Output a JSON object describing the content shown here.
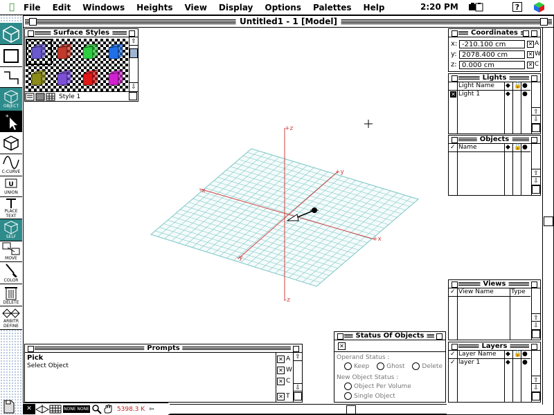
{
  "menubar": {
    "items": [
      "File",
      "Edit",
      "Windows",
      "Heights",
      "View",
      "Display",
      "Options",
      "Palettes",
      "Help"
    ],
    "clock": "2:20 PM"
  },
  "window": {
    "title": "Untitled1 - 1 [Model]"
  },
  "tools": [
    {
      "name": "cube-tool",
      "label": ""
    },
    {
      "name": "rectangle-tool",
      "label": ""
    },
    {
      "name": "step-line-tool",
      "label": ""
    },
    {
      "name": "object-tool",
      "label": "OBJECT"
    },
    {
      "name": "pointer-tool",
      "label": ""
    },
    {
      "name": "cube-wire-tool",
      "label": ""
    },
    {
      "name": "c-curve-tool",
      "label": "C-CURVE"
    },
    {
      "name": "union-tool",
      "label": "UNION"
    },
    {
      "name": "place-text-tool",
      "label": "PLACE TEXT"
    },
    {
      "name": "self-tool",
      "label": "SELF"
    },
    {
      "name": "move-tool",
      "label": "MOVE"
    },
    {
      "name": "color-tool",
      "label": "COLOR"
    },
    {
      "name": "delete-tool",
      "label": "DELETE"
    },
    {
      "name": "arbitr-define-tool",
      "label": "ARBITR DEFINE"
    }
  ],
  "surface_styles": {
    "title": "Surface Styles",
    "style_name": "Style 1",
    "swatches": [
      {
        "color": "#6a5acd"
      },
      {
        "color": "#c0392b"
      },
      {
        "color": "#2ecc40"
      },
      {
        "color": "#1e6fe8"
      },
      {
        "color": "#8b8b1a"
      },
      {
        "color": "#7b4fd8"
      },
      {
        "color": "#e01818"
      },
      {
        "color": "#d020d0"
      }
    ]
  },
  "coordinates": {
    "title": "Coordinates",
    "rows": [
      {
        "axis": "x:",
        "value": "-210.100 cm",
        "flag": "A"
      },
      {
        "axis": "y:",
        "value": "2078.400 cm",
        "flag": "W"
      },
      {
        "axis": "z:",
        "value": "0.000 cm",
        "flag": "C"
      }
    ]
  },
  "lights": {
    "title": "Lights",
    "col": "Light Name",
    "items": [
      "Light 1"
    ]
  },
  "objects": {
    "title": "Objects",
    "col": "Name"
  },
  "views": {
    "title": "Views",
    "col1": "View Name",
    "col2": "Type"
  },
  "layers": {
    "title": "Layers",
    "col": "Layer Name",
    "items": [
      "layer 1"
    ]
  },
  "prompts": {
    "title": "Prompts",
    "heading": "Pick",
    "text": "Select Object",
    "flags": [
      "A",
      "W",
      "C",
      "T"
    ]
  },
  "status_objects": {
    "title": "Status Of Objects",
    "operand_label": "Operand Status :",
    "operand_options": [
      "Keep",
      "Ghost",
      "Delete"
    ],
    "new_label": "New Object Status :",
    "new_options": [
      "Object Per Volume",
      "Single Object"
    ]
  },
  "statusbar": {
    "mode": "NONE NONE",
    "memory": "5398.3 K"
  },
  "axes": {
    "z_top": "+z",
    "z_bottom": "-z",
    "y_pos": "+y",
    "x_pos": "+x",
    "x_neg": "-x",
    "y_neg": "-y"
  },
  "colors": {
    "teal": "#2e8b8b",
    "grid": "#7fc6c6",
    "axis": "#d04040"
  }
}
